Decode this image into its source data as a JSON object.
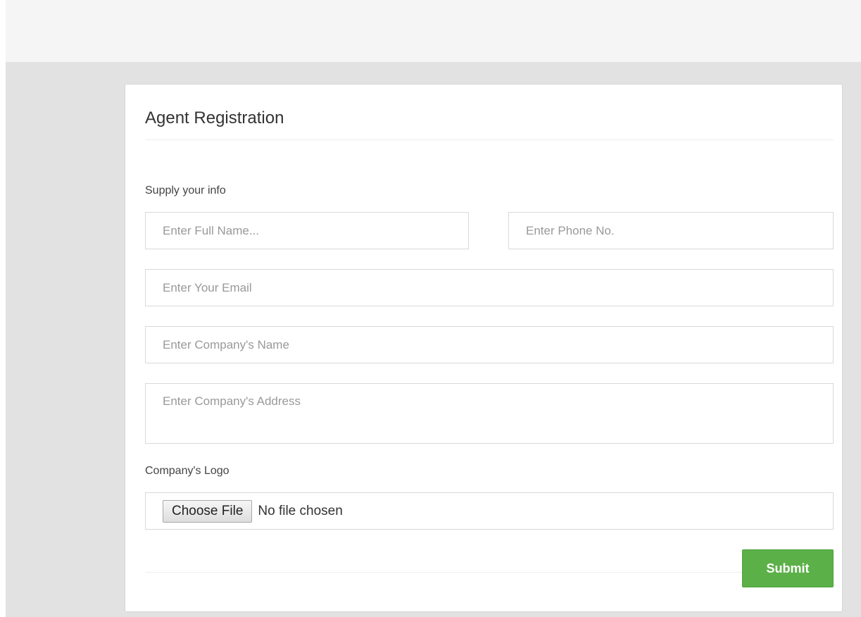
{
  "panel": {
    "title": "Agent Registration"
  },
  "form": {
    "section_label": "Supply your info",
    "full_name": {
      "value": "",
      "placeholder": "Enter Full Name..."
    },
    "phone": {
      "value": "",
      "placeholder": "Enter Phone No."
    },
    "email": {
      "value": "",
      "placeholder": "Enter Your Email"
    },
    "company_name": {
      "value": "",
      "placeholder": "Enter Company's Name"
    },
    "company_address": {
      "value": "",
      "placeholder": "Enter Company's Address"
    },
    "logo_label": "Company's Logo",
    "file_button_label": "Choose File",
    "file_status": "No file chosen",
    "submit_label": "Submit"
  },
  "colors": {
    "submit_button": "#5cb048",
    "content_background": "#e2e2e2",
    "topbar_background": "#f5f5f5"
  }
}
